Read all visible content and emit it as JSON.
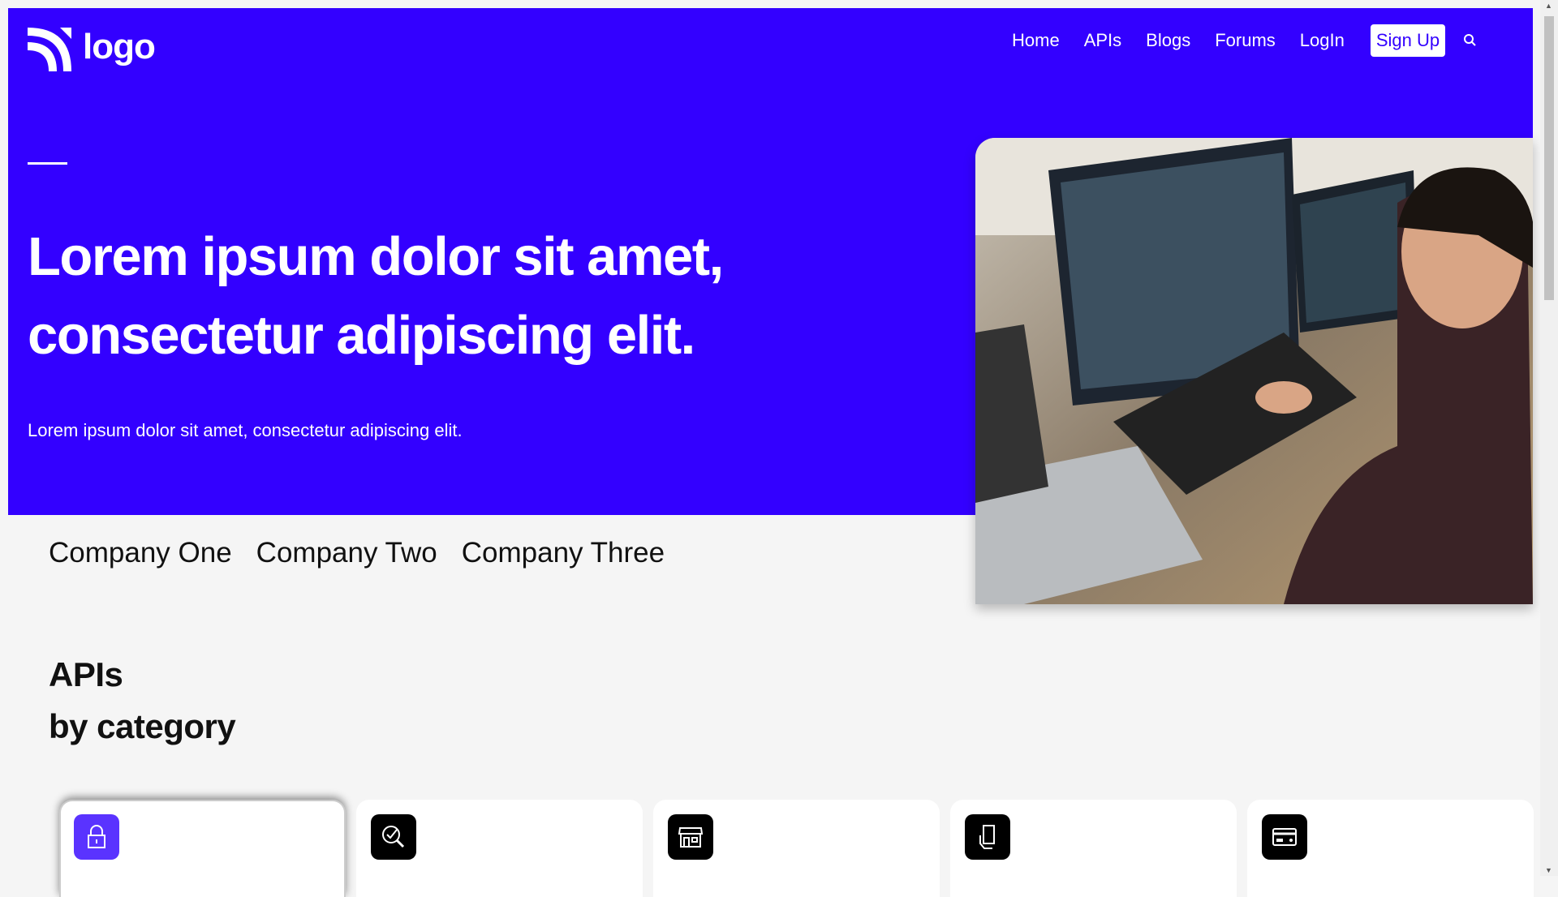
{
  "brand": {
    "logo_text": "logo",
    "accent": "#3300ff"
  },
  "nav": {
    "items": [
      "Home",
      "APIs",
      "Blogs",
      "Forums",
      "LogIn"
    ],
    "signup": "Sign Up",
    "search_icon": "search-icon"
  },
  "hero": {
    "headline_line1": "Lorem ipsum dolor sit amet,",
    "headline_line2": "consectetur adipiscing elit.",
    "subtitle": "Lorem ipsum dolor sit amet, consectetur adipiscing elit.",
    "image": "developer-at-computers-photo"
  },
  "companies": [
    "Company One",
    "Company Two",
    "Company Three"
  ],
  "section": {
    "title_line1": "APIs",
    "title_line2": "by category"
  },
  "categories": [
    {
      "icon": "lock-icon"
    },
    {
      "icon": "search-check-icon"
    },
    {
      "icon": "store-icon"
    },
    {
      "icon": "phone-hand-icon"
    },
    {
      "icon": "credit-card-icon"
    }
  ]
}
